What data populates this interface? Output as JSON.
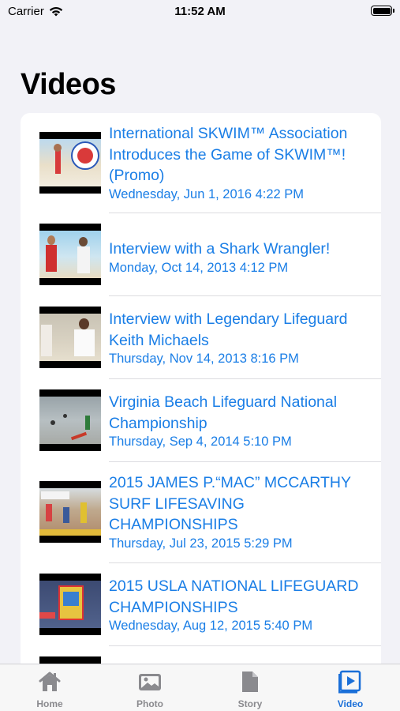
{
  "status_bar": {
    "carrier": "Carrier",
    "time": "11:52 AM",
    "icons": [
      "wifi-icon",
      "battery-icon"
    ]
  },
  "page": {
    "title": "Videos"
  },
  "videos": [
    {
      "title": "International SKWIM™ Association Introduces the Game of SKWIM™! (Promo)",
      "date": "Wednesday, Jun 1, 2016 4:22 PM"
    },
    {
      "title": "Interview with a Shark Wrangler!",
      "date": "Monday, Oct 14, 2013 4:12 PM"
    },
    {
      "title": "Interview with Legendary Lifeguard Keith Michaels",
      "date": "Thursday, Nov 14, 2013 8:16 PM"
    },
    {
      "title": "Virginia Beach Lifeguard National Championship",
      "date": "Thursday, Sep 4, 2014 5:10 PM"
    },
    {
      "title": "2015 JAMES P.“MAC” MCCARTHY SURF LIFESAVING CHAMPIONSHIPS",
      "date": "Thursday, Jul 23, 2015 5:29 PM"
    },
    {
      "title": "2015 USLA NATIONAL LIFEGUARD CHAMPIONSHIPS",
      "date": "Wednesday, Aug 12, 2015 5:40 PM"
    }
  ],
  "tab_bar": {
    "tabs": [
      {
        "label": "Home",
        "icon": "home-icon",
        "active": false
      },
      {
        "label": "Photo",
        "icon": "photo-icon",
        "active": false
      },
      {
        "label": "Story",
        "icon": "story-icon",
        "active": false
      },
      {
        "label": "Video",
        "icon": "video-icon",
        "active": true
      }
    ]
  },
  "colors": {
    "accent": "#1a7ee6",
    "active_tab": "#1a6fd8",
    "inactive_tab": "#8a8a8e",
    "background": "#f2f2f7"
  }
}
